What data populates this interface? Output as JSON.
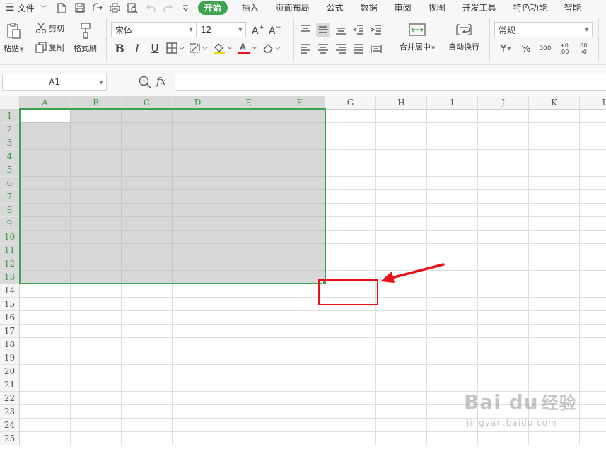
{
  "menubar": {
    "file_label": "文件",
    "tabs": [
      "开始",
      "插入",
      "页面布局",
      "公式",
      "数据",
      "审阅",
      "视图",
      "开发工具",
      "特色功能",
      "智能"
    ],
    "active_tab": "开始"
  },
  "ribbon": {
    "paste_label": "粘贴",
    "cut_label": "剪切",
    "copy_label": "复制",
    "format_painter_label": "格式刷",
    "font_name": "宋体",
    "font_size": "12",
    "merge_center_label": "合并居中",
    "wrap_text_label": "自动换行",
    "number_format": "常规",
    "currency_symbol": "¥",
    "percent_symbol": "%",
    "thousands_label": "000",
    "increase_decimal_label": "+0 .00",
    "decrease_decimal_label": ".00 →0",
    "font_color": "#e8131a",
    "fill_color": "#f5d000"
  },
  "formula_bar": {
    "cell_reference": "A1",
    "fx_label": "fx",
    "formula_value": ""
  },
  "sheet": {
    "columns": [
      "A",
      "B",
      "C",
      "D",
      "E",
      "F",
      "G",
      "H",
      "I",
      "J",
      "K",
      "L"
    ],
    "rows": [
      "1",
      "2",
      "3",
      "4",
      "5",
      "6",
      "7",
      "8",
      "9",
      "10",
      "11",
      "12",
      "13",
      "14",
      "15",
      "16",
      "17",
      "18",
      "19",
      "20",
      "21",
      "22",
      "23",
      "24",
      "25"
    ],
    "selected_columns": [
      "A",
      "B",
      "C",
      "D",
      "E",
      "F"
    ],
    "selected_rows": [
      "1",
      "2",
      "3",
      "4",
      "5",
      "6",
      "7",
      "8",
      "9",
      "10",
      "11",
      "12",
      "13"
    ],
    "active_cell": "A1",
    "accent_color": "#3fa24e",
    "annotation_color": "#e8131a"
  },
  "watermark": {
    "brand": "Bai du",
    "brand_cn": "经验",
    "url": "jingyan.baidu.com"
  }
}
